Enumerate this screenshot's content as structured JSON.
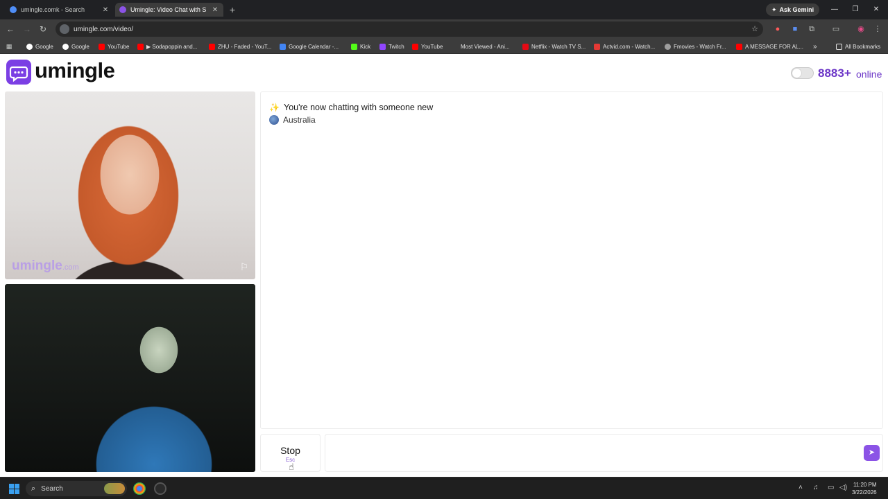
{
  "browser": {
    "tabs": [
      {
        "title": "umingle.comk - Search",
        "close": "✕",
        "favicon_color": "#4f8ef7"
      },
      {
        "title": "Umingle: Video Chat with S",
        "close": "✕",
        "favicon_color": "#8b53e6"
      }
    ],
    "new_tab": "+",
    "gemini_label": "Ask Gemini",
    "window_controls": [
      "—",
      "❐",
      "✕"
    ],
    "url": "umingle.com/video/",
    "bookmarks": [
      {
        "label": "Google",
        "color": "#ffffff"
      },
      {
        "label": "Google",
        "color": "#ffffff"
      },
      {
        "label": "YouTube",
        "color": "#ff0000"
      },
      {
        "label": "▶ Sodapoppin and...",
        "color": "#ff0000"
      },
      {
        "label": "ZHU - Faded - YouT...",
        "color": "#ff0000"
      },
      {
        "label": "Google Calendar -...",
        "color": "#4285f4"
      },
      {
        "label": "Kick",
        "color": "#53fc18"
      },
      {
        "label": "Twitch",
        "color": "#9146ff"
      },
      {
        "label": "YouTube",
        "color": "#ff0000"
      },
      {
        "label": "Most Viewed - Ani...",
        "color": "#3c3c3c"
      },
      {
        "label": "Netflix - Watch TV S...",
        "color": "#e50914"
      },
      {
        "label": "Actvid.com - Watch...",
        "color": "#e53935"
      },
      {
        "label": "Fmovies - Watch Fr...",
        "color": "#9e9e9e"
      },
      {
        "label": "A MESSAGE FOR AL...",
        "color": "#ff0000"
      }
    ],
    "bookmarks_overflow": "»",
    "all_bookmarks": "All Bookmarks"
  },
  "site": {
    "logo": "umingle",
    "online_count": "8883+",
    "online_label": "online",
    "brand_color": "#7b3fe4"
  },
  "videos": {
    "stranger_watermark": "umingle",
    "stranger_watermark_suffix": ".com"
  },
  "chat": {
    "status_message": "You're now chatting with someone new",
    "country": "Australia"
  },
  "controls": {
    "stop_label": "Stop",
    "stop_hint": "Esc",
    "message_placeholder": ""
  },
  "taskbar": {
    "search_label": "Search",
    "time": "11:20 PM",
    "date": "3/22/2026"
  }
}
